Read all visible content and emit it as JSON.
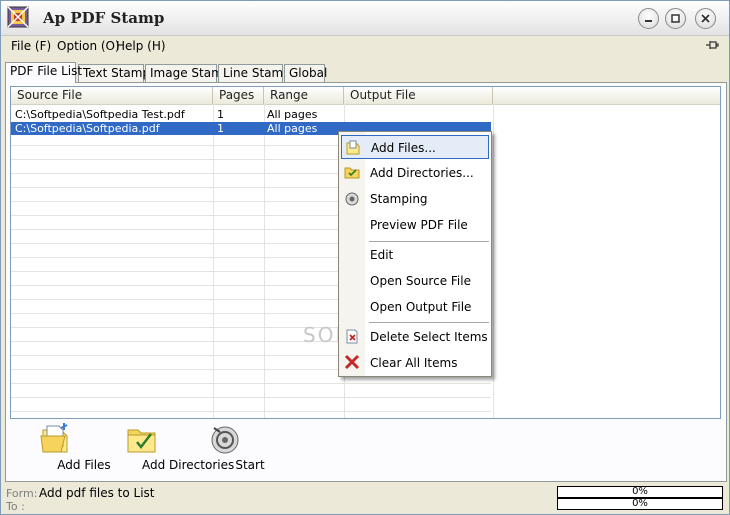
{
  "window": {
    "title": "Ap PDF Stamp"
  },
  "menu": {
    "file": "File (F)",
    "option": "Option (O)",
    "help": "Help (H)"
  },
  "tabs": [
    "PDF File List",
    "Text Stamp",
    "Image Stamp",
    "Line Stamp",
    "Global"
  ],
  "table": {
    "columns": [
      "Source File",
      "Pages",
      "Range",
      "Output File"
    ],
    "rows": [
      {
        "source": "C:\\Softpedia\\Softpedia Test.pdf",
        "pages": "1",
        "range": "All pages",
        "output": ""
      },
      {
        "source": "C:\\Softpedia\\Softpedia.pdf",
        "pages": "1",
        "range": "All pages",
        "output": ""
      }
    ]
  },
  "toolbar": {
    "add_files": "Add Files",
    "add_directories": "Add Directories",
    "start": "Start"
  },
  "context_menu": {
    "add_files": "Add Files...",
    "add_directories": "Add Directories...",
    "stamping": "Stamping",
    "preview": "Preview PDF File",
    "edit": "Edit",
    "open_source": "Open Source File",
    "open_output": "Open Output File",
    "delete_select": "Delete Select Items",
    "clear_all": "Clear All Items"
  },
  "status": {
    "form_label": "Form:",
    "form_text": "Add pdf files to List",
    "to_label": "To :",
    "progress1": "0%",
    "progress2": "0%"
  },
  "colors": {
    "selection": "#316ac5",
    "window_bg": "#ece9d8"
  }
}
